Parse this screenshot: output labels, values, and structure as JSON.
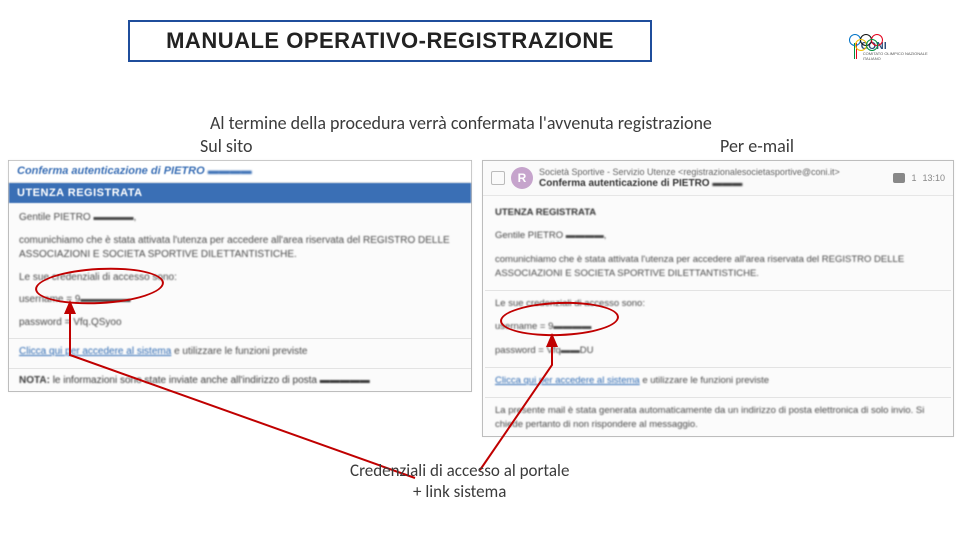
{
  "header": {
    "title": "MANUALE OPERATIVO-REGISTRAZIONE",
    "logo": {
      "brand": "CONI",
      "sub": "COMITATO OLIMPICO NAZIONALE ITALIANO"
    }
  },
  "intro": "Al termine della procedura verrà confermata l'avvenuta registrazione",
  "columns": {
    "left_label": "Sul sito",
    "right_label": "Per e-mail"
  },
  "site_panel": {
    "title_prefix": "Conferma autenticazione di PIETRO",
    "section": "UTENZA REGISTRATA",
    "greeting_prefix": "Gentile PIETRO",
    "body": "comunichiamo che è stata attivata l'utenza per accedere all'area riservata del REGISTRO DELLE ASSOCIAZIONI E SOCIETA SPORTIVE DILETTANTISTICHE.",
    "cred_intro": "Le sue credenziali di accesso sono:",
    "cred_user_prefix": "username = 9",
    "cred_pass_prefix": "password = Vfq.QSyoo",
    "link_text": "Clicca qui per accedere al sistema",
    "link_suffix": " e utilizzare le funzioni previste",
    "nota_label": "NOTA:",
    "nota_text": " le informazioni sono state inviate anche all'indirizzo di posta"
  },
  "email_panel": {
    "avatar_initial": "R",
    "sender": "Società Sportive - Servizio Utenze <registrazionalesocietasportive@coni.it>",
    "subject_prefix": "Conferma autenticazione di PIETRO",
    "recipients_count": "1",
    "time": "13:10",
    "section": "UTENZA REGISTRATA",
    "greeting_prefix": "Gentile PIETRO",
    "body": "comunichiamo che è stata attivata l'utenza per accedere all'area riservata del REGISTRO DELLE ASSOCIAZIONI E SOCIETA SPORTIVE DILETTANTISTICHE.",
    "cred_intro": "Le sue credenziali di accesso sono:",
    "cred_user_prefix": "username = 9",
    "cred_pass_prefix": "password = Vfq",
    "cred_pass_suffix": "DU",
    "link_text": "Clicca qui per accedere al sistema",
    "link_suffix": " e utilizzare le funzioni previste",
    "footer_note": "La presente mail è stata generata automaticamente da un indirizzo di posta elettronica di solo invio. Si chiede pertanto di non rispondere al messaggio."
  },
  "annotation": {
    "caption_line1": "Credenziali di accesso al portale",
    "caption_line2": "+ link sistema"
  }
}
